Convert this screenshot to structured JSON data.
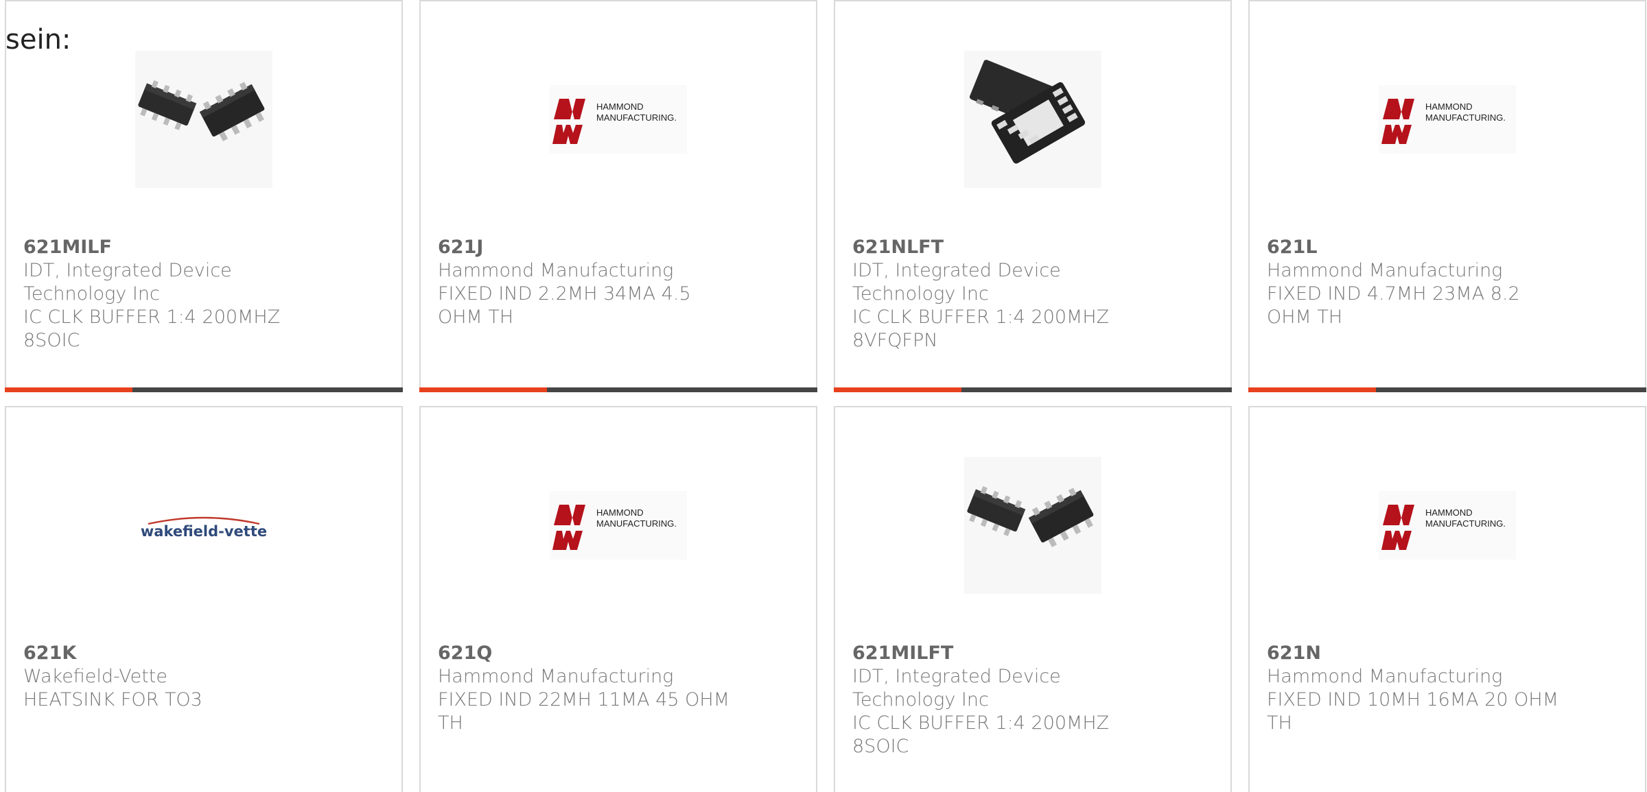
{
  "intro": {
    "text": "sein:"
  },
  "colors": {
    "accent": "#e8411e",
    "bar_dark": "#454545",
    "text": "#666666",
    "border": "#d9d9d9",
    "hammond_red": "#b5121b"
  },
  "products": [
    {
      "part": "621MILF",
      "manufacturer": "IDT, Integrated Device Technology Inc",
      "description": "IC CLK BUFFER 1:4 200MHZ 8SOIC",
      "image": "soic-chip-icon"
    },
    {
      "part": "621J",
      "manufacturer": "Hammond Manufacturing",
      "description": "FIXED IND 2.2MH 34MA 4.5 OHM TH",
      "image": "hammond-logo"
    },
    {
      "part": "621NLFT",
      "manufacturer": "IDT, Integrated Device Technology Inc",
      "description": "IC CLK BUFFER 1:4 200MHZ 8VFQFPN",
      "image": "qfn-chip-icon"
    },
    {
      "part": "621L",
      "manufacturer": "Hammond Manufacturing",
      "description": "FIXED IND 4.7MH 23MA 8.2 OHM TH",
      "image": "hammond-logo"
    },
    {
      "part": "621K",
      "manufacturer": "Wakefield-Vette",
      "description": "HEATSINK FOR TO3",
      "image": "wakefield-logo"
    },
    {
      "part": "621Q",
      "manufacturer": "Hammond Manufacturing",
      "description": "FIXED IND 22MH 11MA 45 OHM TH",
      "image": "hammond-logo"
    },
    {
      "part": "621MILFT",
      "manufacturer": "IDT, Integrated Device Technology Inc",
      "description": "IC CLK BUFFER 1:4 200MHZ 8SOIC",
      "image": "soic-chip-icon"
    },
    {
      "part": "621N",
      "manufacturer": "Hammond Manufacturing",
      "description": "FIXED IND 10MH 16MA 20 OHM TH",
      "image": "hammond-logo"
    }
  ],
  "logos": {
    "hammond_line1": "HAMMOND",
    "hammond_line2": "MANUFACTURING.",
    "wakefield": "wakefield-vette"
  }
}
